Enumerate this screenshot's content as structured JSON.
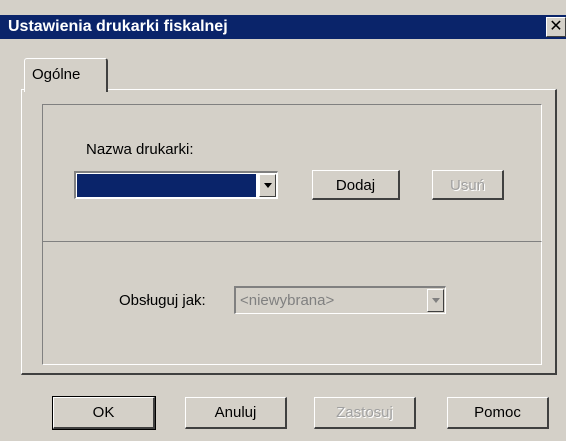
{
  "window": {
    "title": "Ustawienia drukarki fiskalnej",
    "close_glyph": "✕"
  },
  "tabs": [
    {
      "label": "Ogólne",
      "active": true
    }
  ],
  "printer": {
    "label": "Nazwa drukarki:",
    "selected_value": "",
    "add_label": "Dodaj",
    "remove_label": "Usuń"
  },
  "handle_as": {
    "label": "Obsługuj jak:",
    "value": "<niewybrana>"
  },
  "footer": {
    "ok_label": "OK",
    "cancel_label": "Anuluj",
    "apply_label": "Zastosuj",
    "help_label": "Pomoc"
  }
}
